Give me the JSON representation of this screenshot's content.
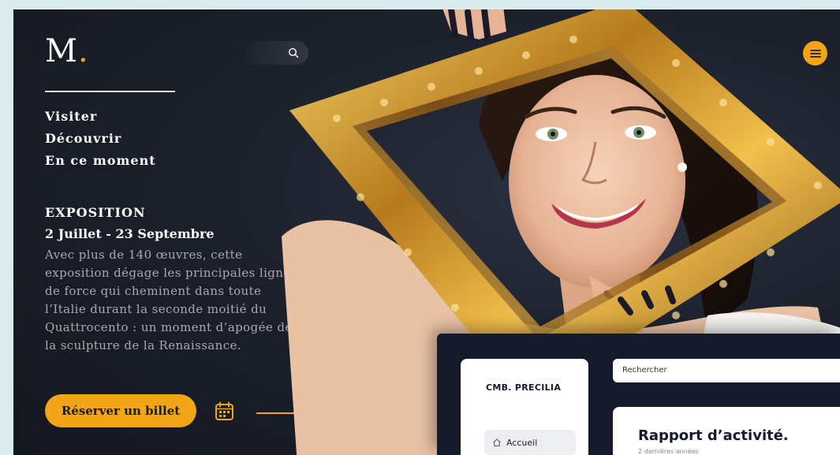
{
  "brand": {
    "letter": "M",
    "dot": "."
  },
  "nav": [
    "Visiter",
    "Découvrir",
    "En ce moment"
  ],
  "exposition": {
    "kicker": "EXPOSITION",
    "dates": "2 Juillet - 23 Septembre",
    "description": "Avec plus de 140 œuvres, cette exposition dégage les principales lignes de force qui cheminent dans toute l’Italie durant la seconde moitié du Quattrocento : un moment d’apogée de la sculpture de la Renaissance."
  },
  "cta": {
    "label": "Réserver un billet"
  },
  "icons": {
    "search": "search-icon",
    "menu": "hamburger-menu-icon",
    "calendar": "calendar-icon",
    "home": "home-icon"
  },
  "colors": {
    "accent": "#f2a516",
    "background": "#1c212c",
    "outer": "#d9ecee"
  },
  "dashboard": {
    "brand": "CMB. PRECILIA",
    "nav_home": "Accueil",
    "search_placeholder": "Rechercher",
    "report_title": "Rapport d’activité.",
    "report_subtitle": "2 dernières années"
  }
}
